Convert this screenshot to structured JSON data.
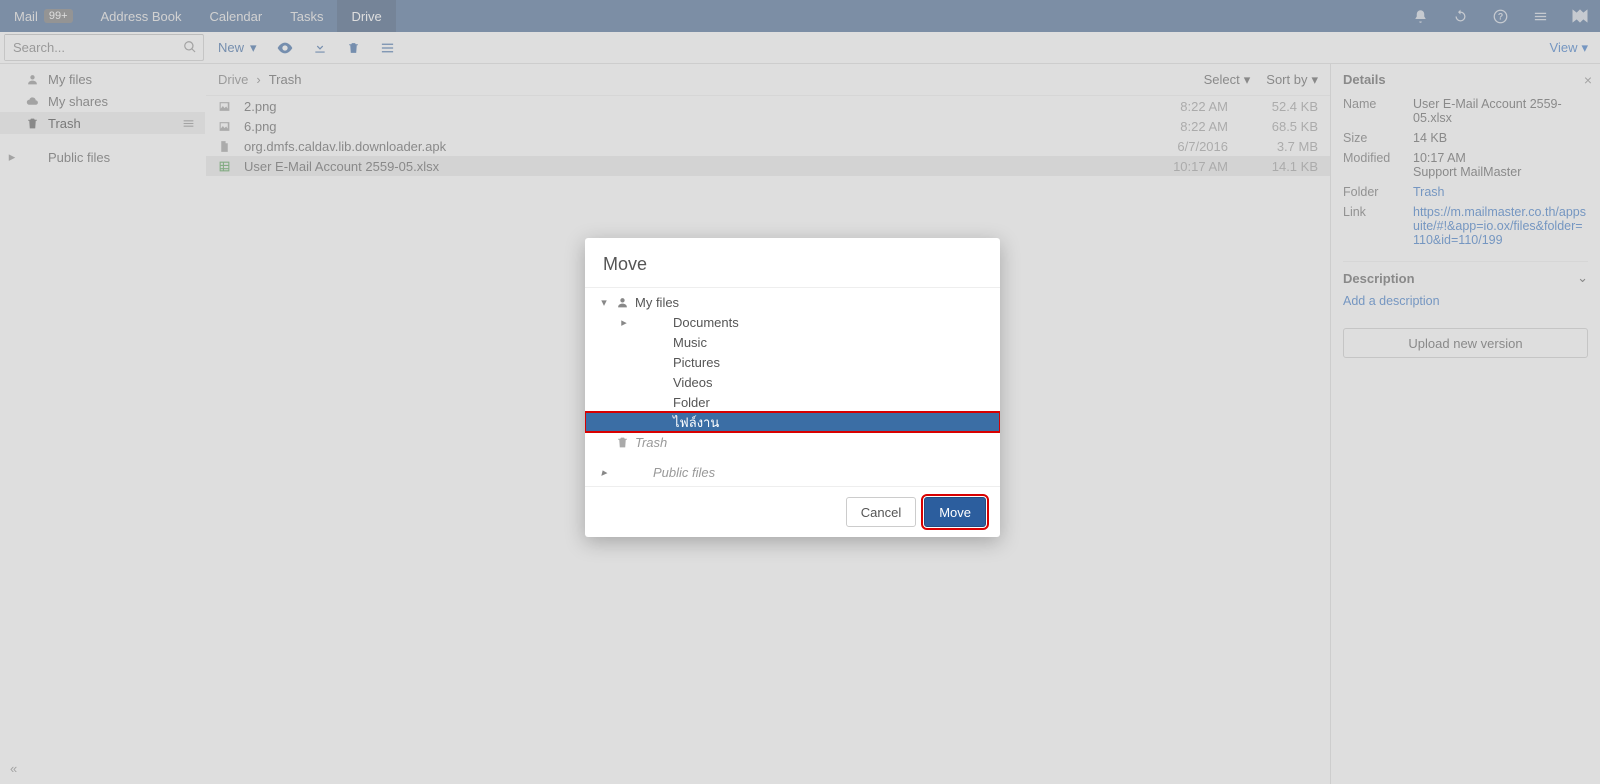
{
  "topbar": {
    "tabs": [
      {
        "label": "Mail",
        "badge": "99+"
      },
      {
        "label": "Address Book"
      },
      {
        "label": "Calendar"
      },
      {
        "label": "Tasks"
      },
      {
        "label": "Drive",
        "active": true
      }
    ]
  },
  "search": {
    "placeholder": "Search..."
  },
  "toolbar": {
    "new": "New"
  },
  "view": "View",
  "sidebar": {
    "items": [
      {
        "label": "My files",
        "icon": "user"
      },
      {
        "label": "My shares",
        "icon": "cloud"
      },
      {
        "label": "Trash",
        "icon": "trash",
        "active": true
      },
      {
        "label": "Public files",
        "expand": true
      }
    ]
  },
  "breadcrumb": [
    "Drive",
    "Trash"
  ],
  "listops": {
    "select": "Select",
    "sort": "Sort by"
  },
  "files": [
    {
      "icon": "image",
      "name": "2.png",
      "date": "8:22 AM",
      "size": "52.4 KB"
    },
    {
      "icon": "image",
      "name": "6.png",
      "date": "8:22 AM",
      "size": "68.5 KB"
    },
    {
      "icon": "file",
      "name": "org.dmfs.caldav.lib.downloader.apk",
      "date": "6/7/2016",
      "size": "3.7 MB"
    },
    {
      "icon": "sheet",
      "name": "User E-Mail Account 2559-05.xlsx",
      "date": "10:17 AM",
      "size": "14.1 KB",
      "selected": true
    }
  ],
  "details": {
    "title": "Details",
    "rows": {
      "name_lbl": "Name",
      "name_val": "User E-Mail Account 2559-05.xlsx",
      "size_lbl": "Size",
      "size_val": "14 KB",
      "mod_lbl": "Modified",
      "mod_val": "10:17 AM",
      "mod_val2": "Support MailMaster",
      "folder_lbl": "Folder",
      "folder_val": "Trash",
      "link_lbl": "Link",
      "link_val": "https://m.mailmaster.co.th/appsuite/#!&app=io.ox/files&folder=110&id=110/199"
    },
    "desc_title": "Description",
    "add_desc": "Add a description",
    "upload": "Upload new version"
  },
  "modal": {
    "title": "Move",
    "tree": [
      {
        "indent": 0,
        "exp": "down",
        "icon": "user",
        "label": "My files"
      },
      {
        "indent": 1,
        "exp": "right",
        "label": "Documents"
      },
      {
        "indent": 1,
        "label": "Music"
      },
      {
        "indent": 1,
        "label": "Pictures"
      },
      {
        "indent": 1,
        "label": "Videos"
      },
      {
        "indent": 1,
        "label": "Folder"
      },
      {
        "indent": 1,
        "label": "ไฟล์งาน",
        "selected": true
      },
      {
        "indent": 0,
        "icon": "trash",
        "label": "Trash",
        "ital": true
      },
      {
        "indent": 0,
        "exp": "right",
        "label": "Public files",
        "ital": true,
        "sep": true
      }
    ],
    "cancel": "Cancel",
    "move": "Move"
  }
}
